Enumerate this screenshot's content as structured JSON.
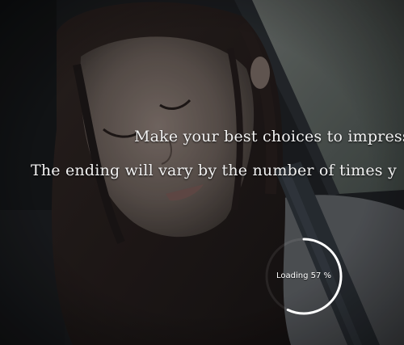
{
  "dialogue": {
    "line1": "Make your best choices to impress",
    "line2": "The ending will vary by the number of times y"
  },
  "loading": {
    "label": "Loading",
    "percent": 57,
    "percent_text": "57 %"
  },
  "scene": {
    "subject": "girl asleep against car window with seatbelt",
    "accent_color": "#ffffff"
  }
}
